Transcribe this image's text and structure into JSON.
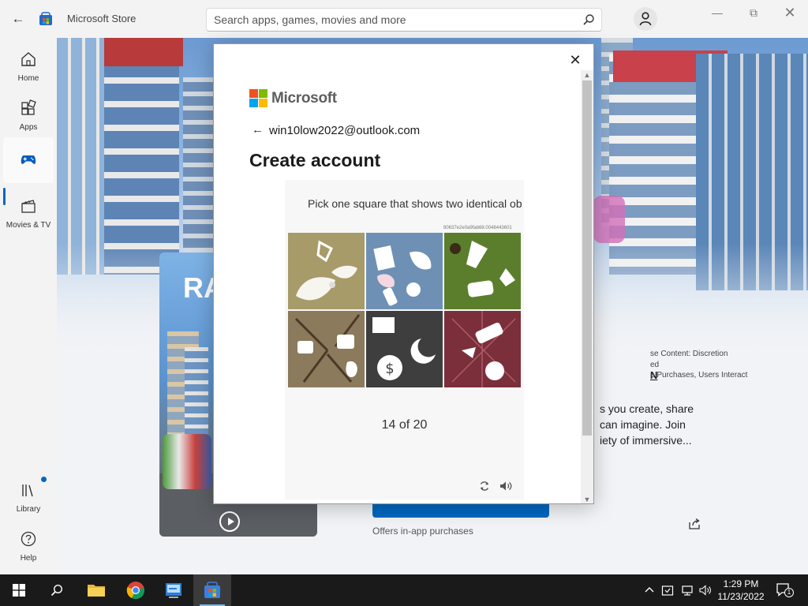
{
  "titlebar": {
    "app_title": "Microsoft Store",
    "search_placeholder": "Search apps, games, movies and more",
    "icons": [
      "back-arrow-icon",
      "store-logo-icon",
      "search-icon",
      "user-icon",
      "minimize-icon",
      "maximize-icon",
      "close-icon"
    ]
  },
  "nav": {
    "items": [
      {
        "label": "Home",
        "icon": "home-icon"
      },
      {
        "label": "Apps",
        "icon": "apps-icon"
      },
      {
        "label": "",
        "icon": "gaming-icon",
        "active": true
      },
      {
        "label": "Movies & TV",
        "icon": "movies-icon"
      },
      {
        "label": "Library",
        "icon": "library-icon",
        "badge": true
      },
      {
        "label": "Help",
        "icon": "help-icon"
      }
    ]
  },
  "product": {
    "thumb_title": "RA",
    "title_fragment": "N",
    "rating_line1": "se Content: Discretion",
    "rating_line2": "ed",
    "rating_line3": "p Purchases, Users Interact",
    "desc_line1": "s you create, share",
    "desc_line2": "can imagine. Join",
    "desc_line3": "iety of immersive...",
    "offers": "Offers in-app purchases"
  },
  "dialog": {
    "brand": "Microsoft",
    "email": "win10low2022@outlook.com",
    "heading": "Create account",
    "captcha": {
      "instruction": "Pick one square that shows two identical ob",
      "challenge_id": "80637e2e0a9fab68.0048443601",
      "counter": "14 of 20",
      "tiles": [
        {
          "name": "tile-1",
          "bg": "#a89b6a"
        },
        {
          "name": "tile-2",
          "bg": "#6e90b4"
        },
        {
          "name": "tile-3",
          "bg": "#5b7e2c"
        },
        {
          "name": "tile-4",
          "bg": "#8b7a5c"
        },
        {
          "name": "tile-5",
          "bg": "#3e3e3e"
        },
        {
          "name": "tile-6",
          "bg": "#7a2f3a"
        }
      ]
    }
  },
  "taskbar": {
    "apps": [
      "windows-start-icon",
      "search-icon",
      "file-explorer-icon",
      "chrome-icon",
      "control-panel-icon",
      "store-icon"
    ],
    "time": "1:29 PM",
    "date": "11/23/2022",
    "notification_count": "1"
  },
  "colors": {
    "accent": "#0067c0",
    "ms_red": "#f25022",
    "ms_green": "#7fba00",
    "ms_blue": "#00a4ef",
    "ms_yellow": "#ffb900"
  }
}
